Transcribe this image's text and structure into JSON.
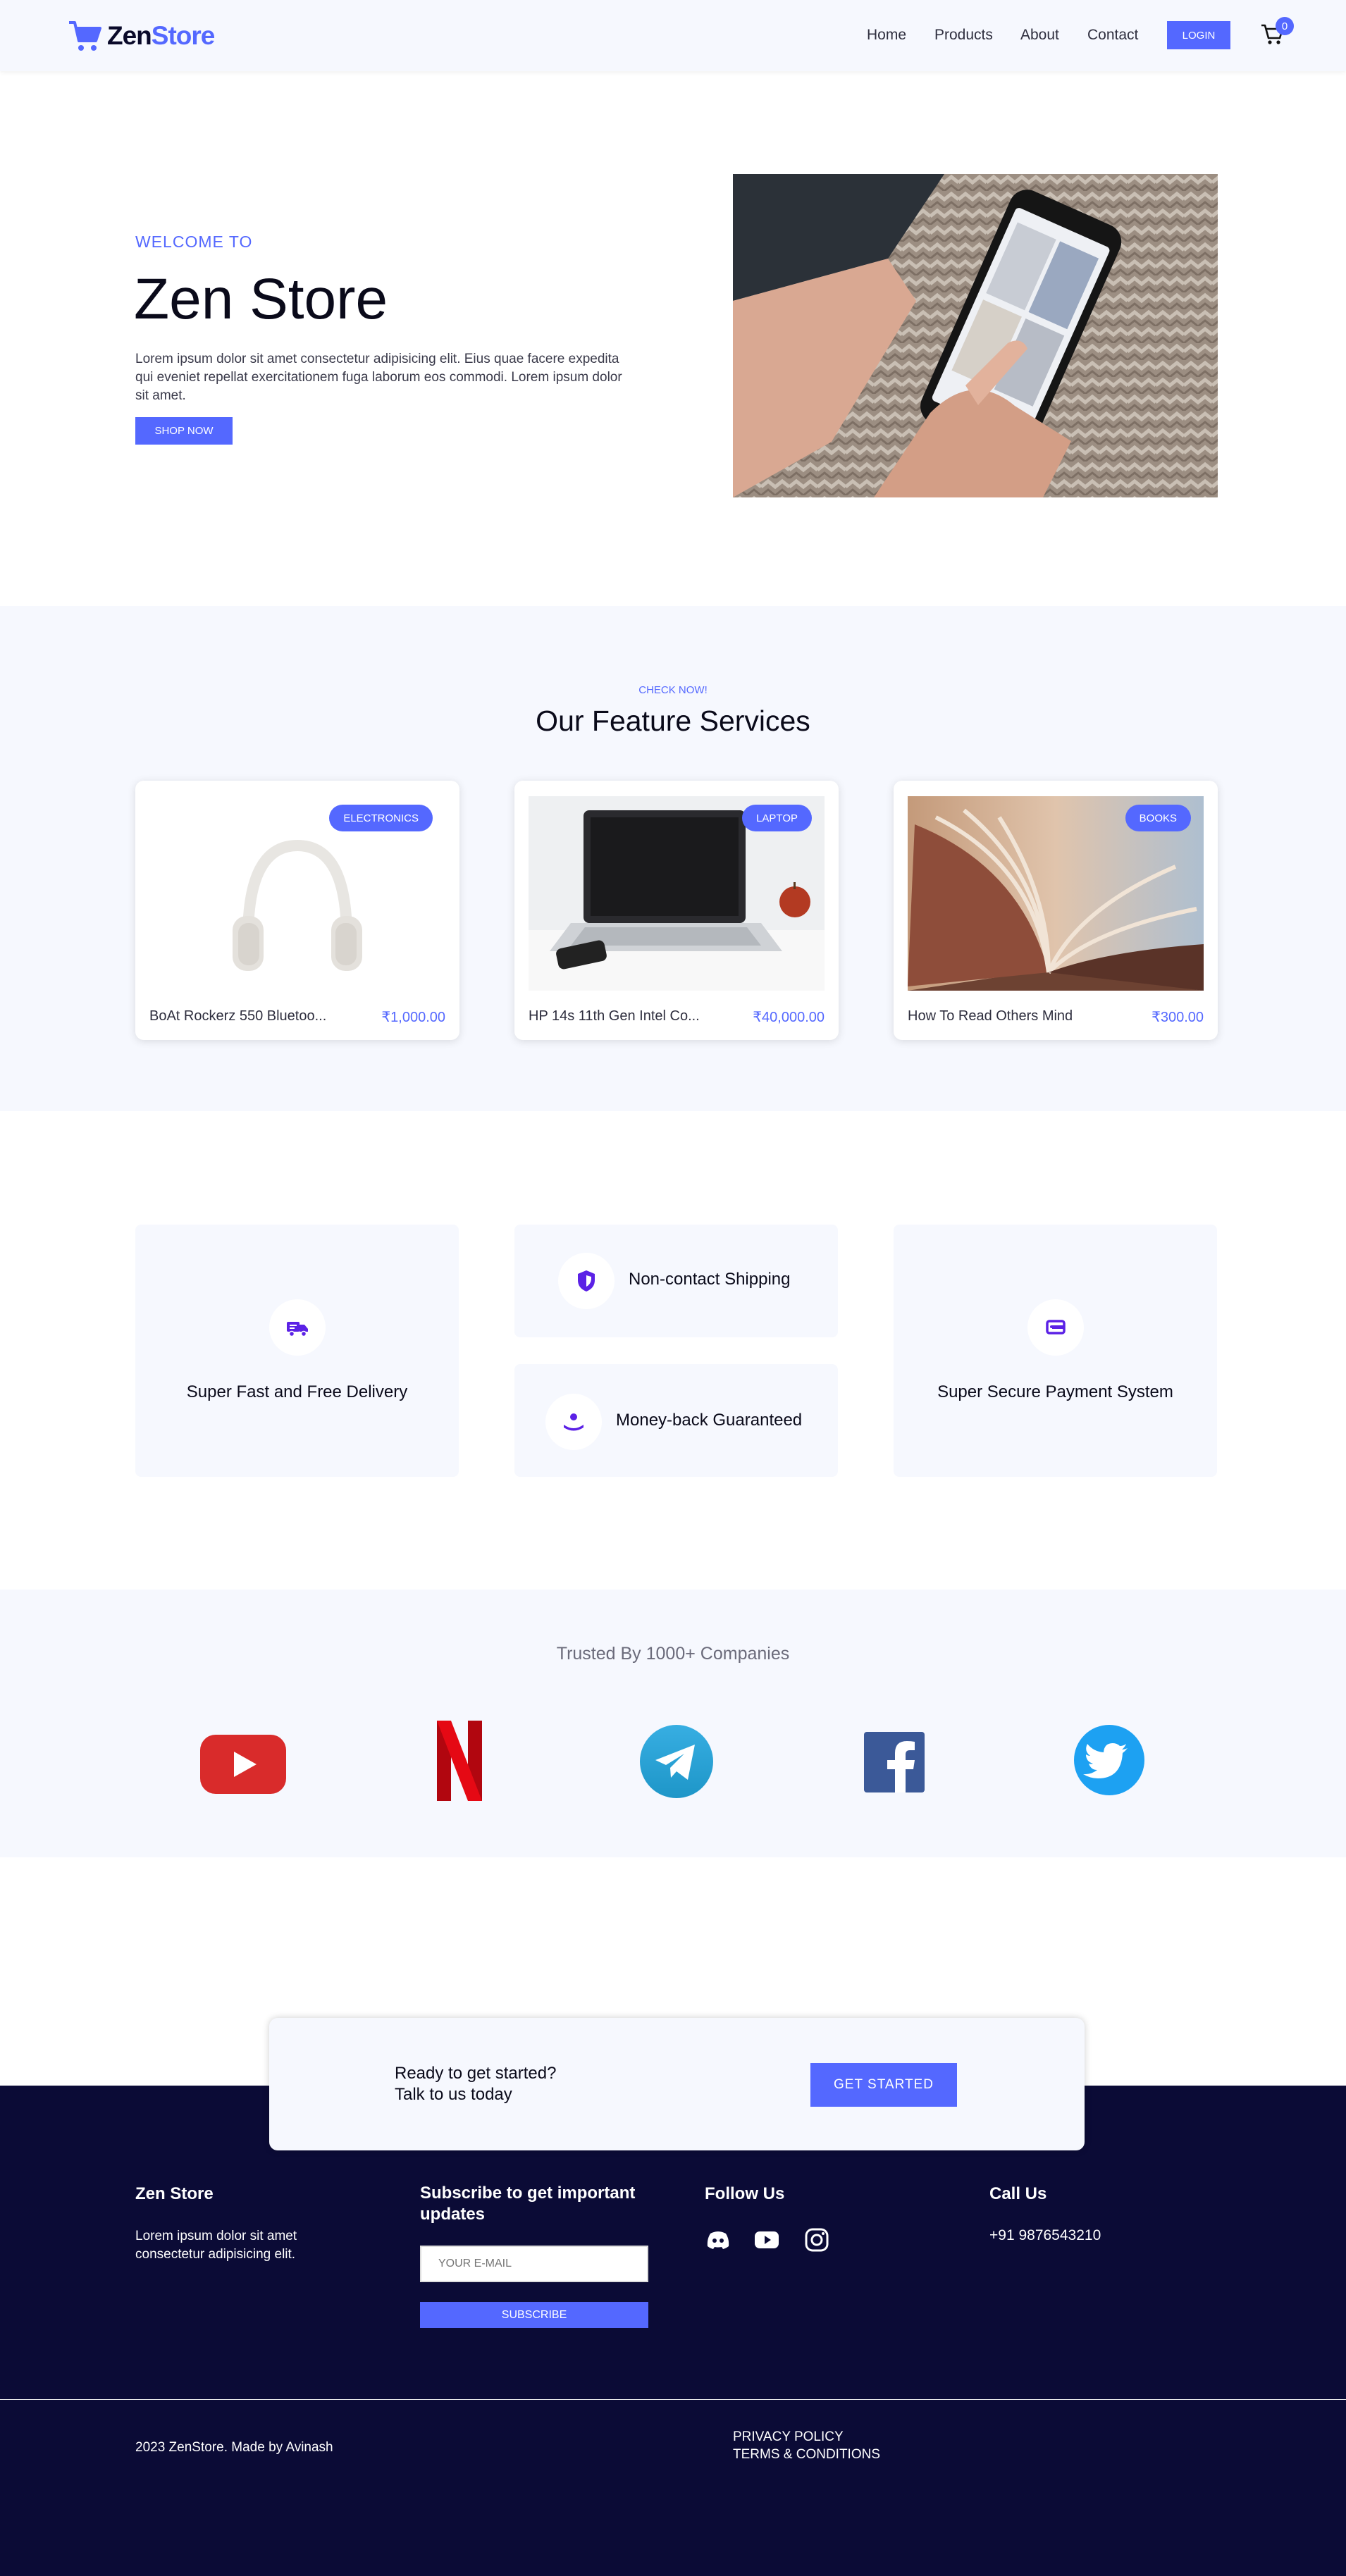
{
  "nav": {
    "logo_prefix": "Zen",
    "logo_suffix": "Store",
    "links": [
      "Home",
      "Products",
      "About",
      "Contact"
    ],
    "login": "LOGIN",
    "cart_count": "0"
  },
  "hero": {
    "kicker": "WELCOME TO",
    "title": "Zen Store",
    "text": "Lorem ipsum dolor sit amet consectetur adipisicing elit. Eius quae facere expedita qui eveniet repellat exercitationem fuga laborum eos commodi. Lorem ipsum dolor sit amet.",
    "button": "SHOP NOW"
  },
  "services": {
    "kicker": "CHECK NOW!",
    "title": "Our Feature Services",
    "cards": [
      {
        "badge": "ELECTRONICS",
        "name": "BoAt Rockerz 550 Bluetoo...",
        "price": "₹1,000.00"
      },
      {
        "badge": "LAPTOP",
        "name": "HP 14s 11th Gen Intel Co...",
        "price": "₹40,000.00"
      },
      {
        "badge": "BOOKS",
        "name": "How To Read Others Mind",
        "price": "₹300.00"
      }
    ]
  },
  "features": {
    "delivery": "Super Fast and Free Delivery",
    "shipping": "Non-contact Shipping",
    "moneyback": "Money-back Guaranteed",
    "payment": "Super Secure Payment System"
  },
  "trusted": {
    "title": "Trusted By 1000+ Companies",
    "brands": [
      "youtube-logo",
      "netflix-logo",
      "telegram-logo",
      "facebook-logo",
      "twitter-logo"
    ]
  },
  "cta": {
    "line1": "Ready to get started?",
    "line2": "Talk to us today",
    "button": "GET STARTED"
  },
  "footer": {
    "brand": "Zen Store",
    "brand_text": "Lorem ipsum dolor sit amet consectetur adipisicing elit.",
    "subscribe_title": "Subscribe to get important updates",
    "email_placeholder": "YOUR E-MAIL",
    "subscribe_button": "SUBSCRIBE",
    "follow_title": "Follow Us",
    "call_title": "Call Us",
    "phone": "+91 9876543210",
    "copyright": "2023 ZenStore. Made by Avinash",
    "privacy": "PRIVACY POLICY",
    "terms": "TERMS & CONDITIONS"
  },
  "colors": {
    "accent": "#5468ff",
    "footer_bg": "#0b0b36",
    "section_bg": "#f6f8fe"
  }
}
